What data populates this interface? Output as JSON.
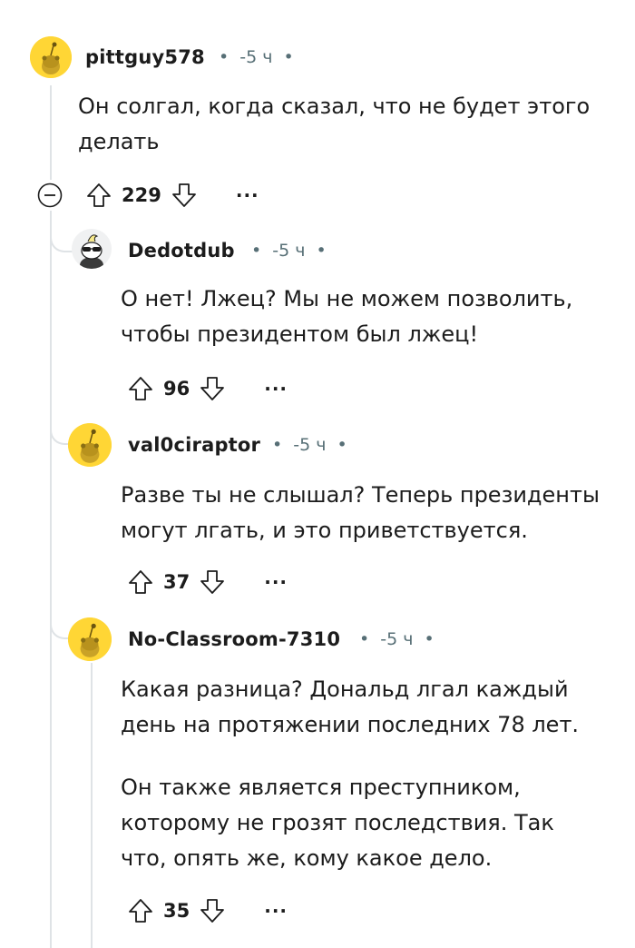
{
  "comments": [
    {
      "username": "pittguy578",
      "time": "-5 ч",
      "text": [
        "Он солгал, когда сказал, что не будет этого",
        "делать"
      ],
      "score": "229",
      "avatar": "snoo-yellow"
    },
    {
      "username": "Dedotdub",
      "time": "-5 ч",
      "text": [
        "О нет! Лжец? Мы не можем позволить,",
        "чтобы президентом был лжец!"
      ],
      "score": "96",
      "avatar": "snoo-sunglasses"
    },
    {
      "username": "val0ciraptor",
      "time": "-5 ч",
      "text": [
        "Разве ты не слышал? Теперь президенты",
        "могут лгать, и это приветствуется."
      ],
      "score": "37",
      "avatar": "snoo-yellow"
    },
    {
      "username": "No-Classroom-7310",
      "time": "-5 ч",
      "text": [
        "Какая разница? Дональд лгал каждый",
        "день на протяжении последних 78 лет.",
        "Он также является преступником,",
        "которому не грозят последствия. Так",
        "что, опять же, кому какое дело."
      ],
      "score": "35",
      "avatar": "snoo-yellow"
    }
  ],
  "ui": {
    "more_label": "...",
    "separator": "•",
    "icons": {
      "upvote": "upvote-arrow-icon",
      "downvote": "downvote-arrow-icon",
      "collapse": "collapse-minus-icon",
      "more": "more-options-icon"
    },
    "colors": {
      "avatar_bg": "#ffd635",
      "meta_text": "#576f76",
      "thread_line": "#dfe3e6"
    }
  }
}
